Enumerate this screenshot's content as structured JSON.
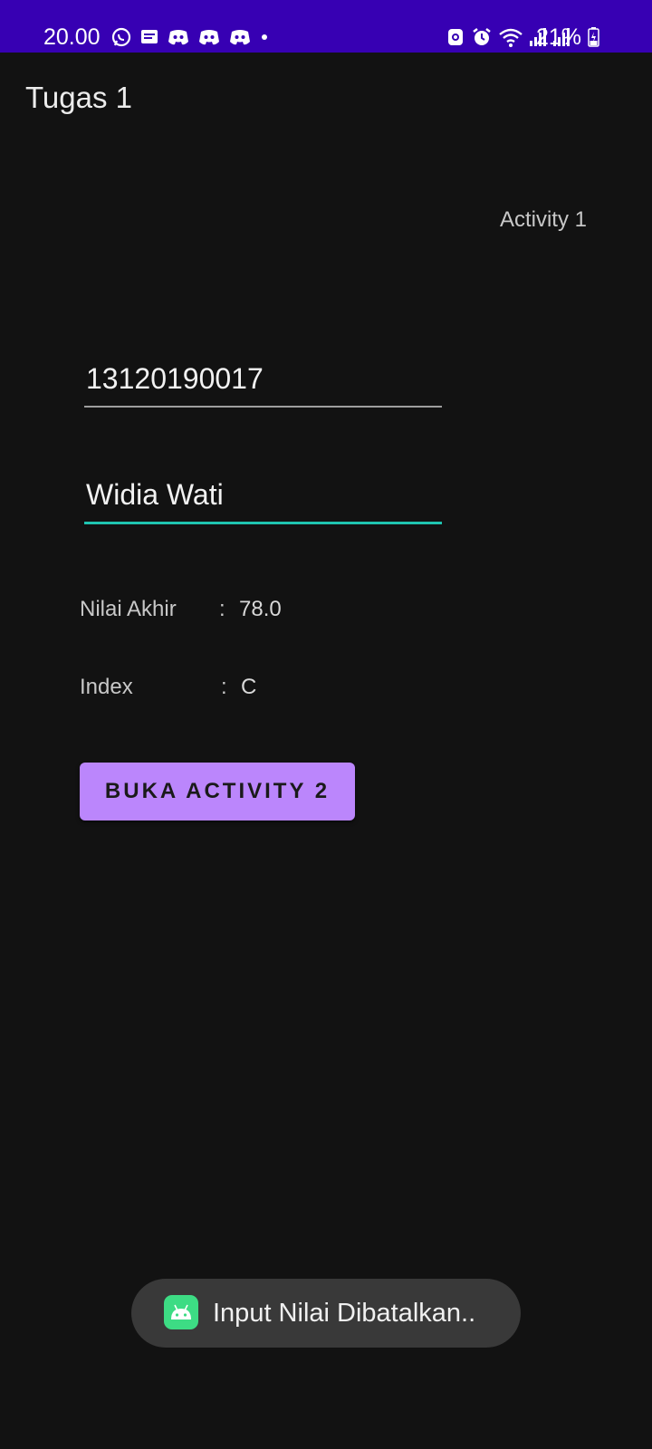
{
  "status_bar": {
    "time": "20.00",
    "battery_percent": "21%",
    "left_icons": [
      "whatsapp-icon",
      "message-icon",
      "discord-icon",
      "discord-icon",
      "discord-icon",
      "dot-icon"
    ],
    "right_icons": [
      "nfc-icon",
      "alarm-icon",
      "wifi-icon",
      "signal-icon",
      "signal-icon"
    ],
    "color": "#3700b3"
  },
  "app_bar": {
    "title": "Tugas 1"
  },
  "main": {
    "activity_label": "Activity 1",
    "nim_field": {
      "value": "13120190017"
    },
    "nama_field": {
      "value": "Widia Wati"
    },
    "nilai_akhir": {
      "label": "Nilai Akhir",
      "separator": ":",
      "value": "78.0"
    },
    "index": {
      "label": "Index",
      "separator": ":",
      "value": "C"
    },
    "open_button_label": "BUKA ACTIVITY 2",
    "accent_color": "#bb86fc",
    "focus_color": "#1fc4b0"
  },
  "toast": {
    "message": "Input Nilai Dibatalkan..",
    "icon": "android-icon"
  }
}
